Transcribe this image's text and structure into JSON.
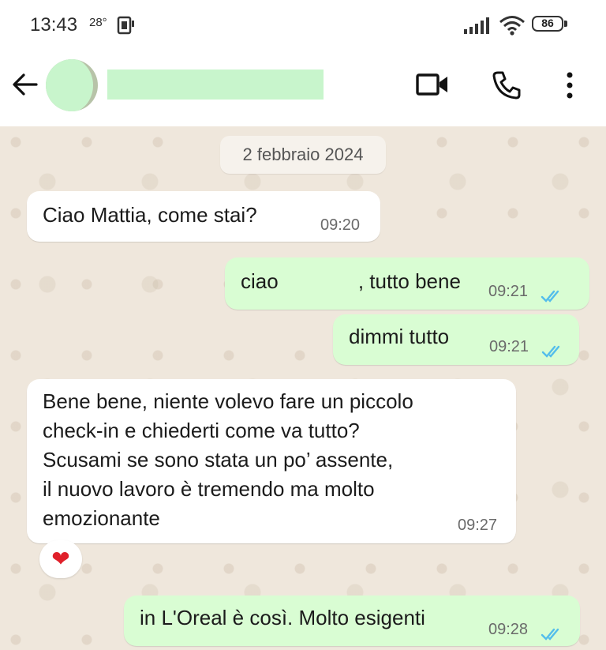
{
  "status_bar": {
    "time": "13:43",
    "temperature": "28°",
    "battery": "86"
  },
  "header": {
    "back_icon": "arrow-back-icon",
    "video_icon": "video-call-icon",
    "phone_icon": "phone-call-icon",
    "menu_icon": "more-vert-icon"
  },
  "chat": {
    "date_label": "2 febbraio 2024",
    "messages": [
      {
        "direction": "in",
        "text": "Ciao Mattia, come stai?",
        "time": "09:20"
      },
      {
        "direction": "out",
        "text": "ciao              , tutto bene",
        "time": "09:21",
        "read": true
      },
      {
        "direction": "out",
        "text": "dimmi tutto",
        "time": "09:21",
        "read": true
      },
      {
        "direction": "in",
        "text": "Bene bene, niente volevo fare un piccolo\ncheck-in e chiederti come va tutto?\nScusami se sono stata un po’ assente,\nil nuovo lavoro è tremendo ma molto\nemozionante",
        "time": "09:27",
        "reaction": "❤"
      },
      {
        "direction": "out",
        "text": "in L'Oreal è così. Molto esigenti",
        "time": "09:28",
        "read": true
      }
    ]
  },
  "colors": {
    "incoming_bubble": "#ffffff",
    "outgoing_bubble": "#d9fdd3",
    "read_ticks": "#53bdeb",
    "chat_background": "#efe7dc"
  }
}
